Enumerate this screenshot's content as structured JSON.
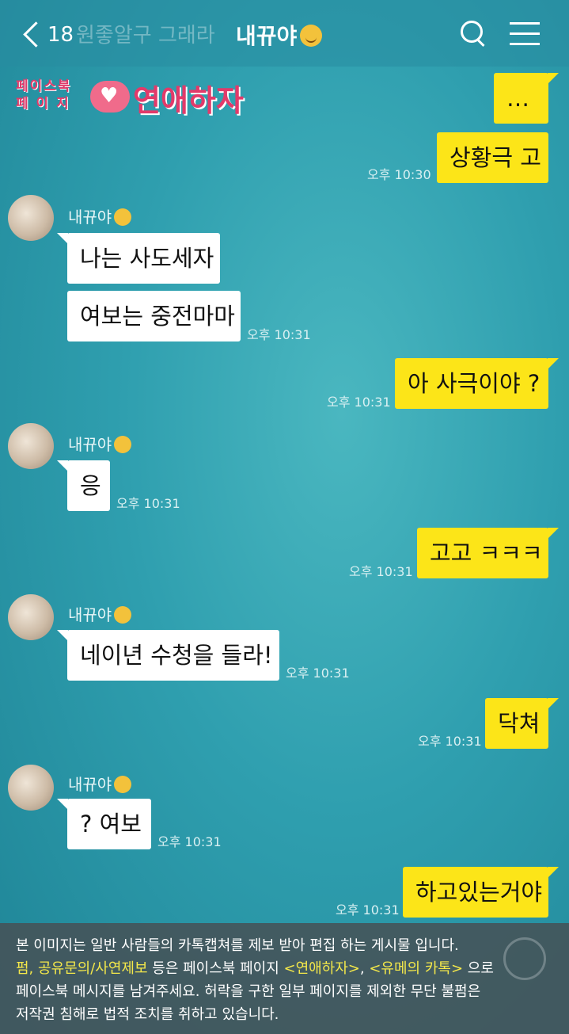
{
  "header": {
    "back_count": "18",
    "bg_title": "원좋알구 그래라",
    "title": "내뀨야",
    "title_emoji": "wink-emoji"
  },
  "logo": {
    "line1": "페이스북",
    "line2": "페 이 지",
    "main": "연애하자"
  },
  "sender_name": "내뀨야",
  "messages": {
    "m1": "…",
    "m2": "상황극 고",
    "t2": "오후 10:30",
    "m3": "나는 사도세자",
    "m4": "여보는 중전마마",
    "t4": "오후 10:31",
    "m5": "아 사극이야 ?",
    "t5": "오후 10:31",
    "m6": "응",
    "t6": "오후 10:31",
    "m7": "고고 ㅋㅋㅋ",
    "t7": "오후 10:31",
    "m8": "네이년 수청을 들라!",
    "t8": "오후 10:31",
    "m9": "닥쳐",
    "t9": "오후 10:31",
    "m10": "? 여보",
    "t10": "오후 10:31",
    "m11": "하고있는거야",
    "t11": "오후 10:31"
  },
  "notice": {
    "line1": "본 이미지는 일반 사람들의 카톡캡쳐를 제보 받아 편집 하는 게시물 입니다.",
    "hl1": "펌, 공유문의/사연제보",
    "mid1": " 등은 페이스북 페이지 ",
    "hl2": "<연애하자>",
    "mid2": ", ",
    "hl3": "<유메의 카톡>",
    "end2": " 으로",
    "line3": "페이스북 메시지를 남겨주세요. 허락을 구한 일부 페이지를 제외한 무단 불펌은",
    "line4": "저작권 침해로 법적 조치를 취하고 있습니다."
  },
  "colors": {
    "outgoing_bubble": "#fce518",
    "incoming_bubble": "#ffffff",
    "background": "#2f9faf",
    "highlight": "#f4e84a"
  }
}
